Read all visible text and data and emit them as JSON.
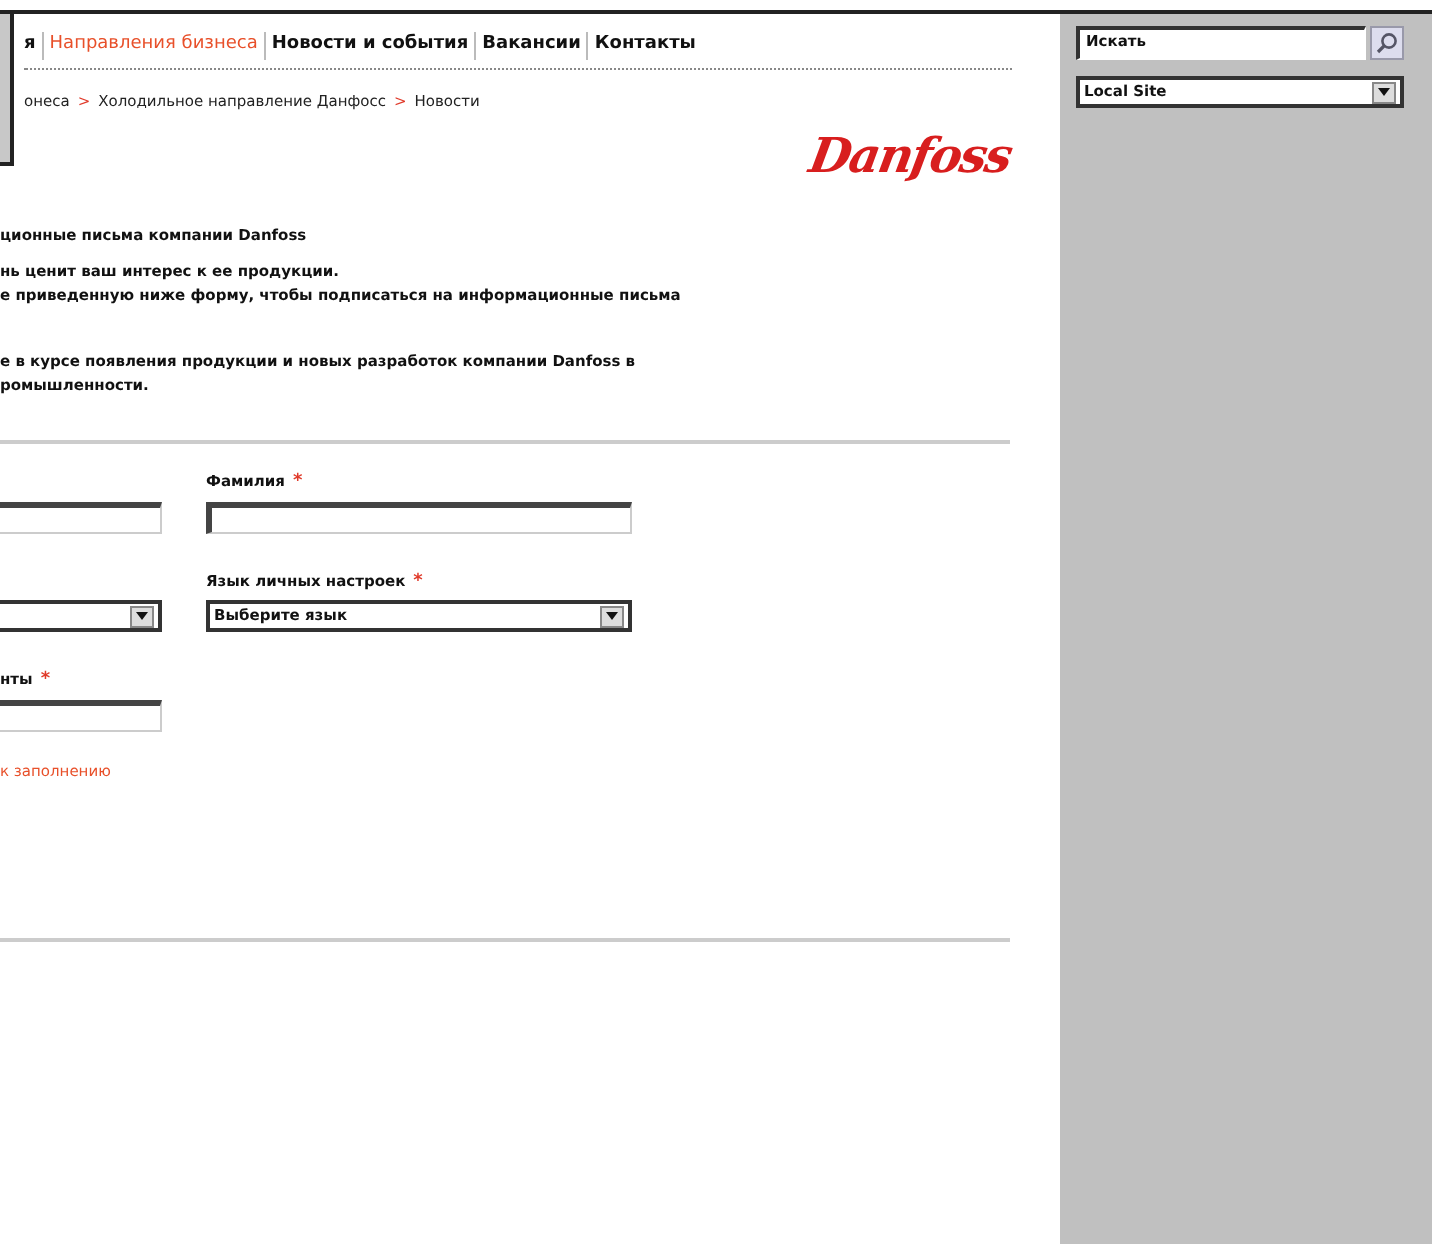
{
  "nav": [
    {
      "label": "я",
      "selected": false
    },
    {
      "label": "Направления бизнеса",
      "selected": true
    },
    {
      "label": "Новости и события",
      "selected": false
    },
    {
      "label": "Вакансии",
      "selected": false
    },
    {
      "label": "Контакты",
      "selected": false
    }
  ],
  "breadcrumb": [
    {
      "kind": "link",
      "text": "онеса"
    },
    {
      "kind": "separator",
      "text": ">"
    },
    {
      "kind": "link",
      "text": "Холодильное направление Данфосс"
    },
    {
      "kind": "separator",
      "text": ">"
    },
    {
      "kind": "link",
      "text": "Новости"
    }
  ],
  "logo": "Danfoss",
  "intro": {
    "title": "ционные письма компании Danfoss",
    "paragraphs": [
      [
        "нь ценит ваш интерес к ее продукции.",
        "е приведенную ниже форму, чтобы подписаться на информационные письма"
      ],
      [
        "е в курсе появления продукции и новых разработок компании Danfoss в",
        "ромышленности."
      ]
    ]
  },
  "form": {
    "rows": [
      [
        {
          "kind": "input"
        },
        {
          "kind": "input",
          "label": "Фамилия",
          "mark": "*"
        }
      ],
      [
        {
          "kind": "select"
        },
        {
          "kind": "select",
          "label": "Язык личных настроек",
          "mark": "*",
          "value": "Выберите язык"
        }
      ],
      [
        {
          "kind": "input",
          "label": "нты",
          "mark": "*"
        }
      ]
    ],
    "required_note": "к заполнению"
  },
  "sidebar": {
    "search": {
      "value": "Искать"
    },
    "site_select": {
      "value": "Local Site"
    }
  }
}
